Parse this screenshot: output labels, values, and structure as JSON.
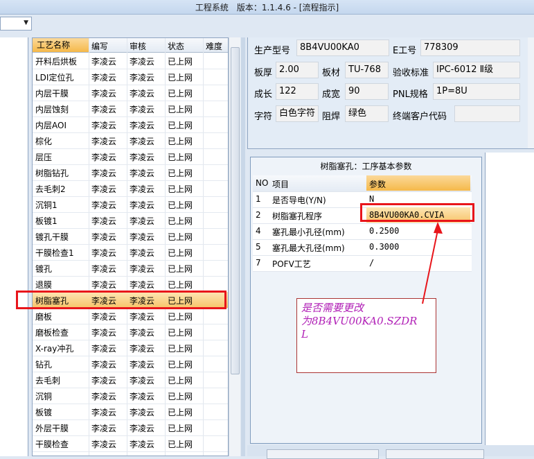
{
  "window": {
    "title": "工程系统　版本：1.1.4.6 - [流程指示]"
  },
  "process_grid": {
    "columns": [
      "工艺名称",
      "编写",
      "审核",
      "状态",
      "难度"
    ],
    "rows": [
      [
        "开料后烘板",
        "李凌云",
        "李凌云",
        "已上网"
      ],
      [
        "LDI定位孔",
        "李凌云",
        "李凌云",
        "已上网"
      ],
      [
        "内层干膜",
        "李凌云",
        "李凌云",
        "已上网"
      ],
      [
        "内层蚀刻",
        "李凌云",
        "李凌云",
        "已上网"
      ],
      [
        "内层AOI",
        "李凌云",
        "李凌云",
        "已上网"
      ],
      [
        "棕化",
        "李凌云",
        "李凌云",
        "已上网"
      ],
      [
        "层压",
        "李凌云",
        "李凌云",
        "已上网"
      ],
      [
        "树脂钻孔",
        "李凌云",
        "李凌云",
        "已上网"
      ],
      [
        "去毛刺2",
        "李凌云",
        "李凌云",
        "已上网"
      ],
      [
        "沉铜1",
        "李凌云",
        "李凌云",
        "已上网"
      ],
      [
        "板镀1",
        "李凌云",
        "李凌云",
        "已上网"
      ],
      [
        "镀孔干膜",
        "李凌云",
        "李凌云",
        "已上网"
      ],
      [
        "干膜检查1",
        "李凌云",
        "李凌云",
        "已上网"
      ],
      [
        "镀孔",
        "李凌云",
        "李凌云",
        "已上网"
      ],
      [
        "退膜",
        "李凌云",
        "李凌云",
        "已上网"
      ],
      [
        "树脂塞孔",
        "李凌云",
        "李凌云",
        "已上网"
      ],
      [
        "磨板",
        "李凌云",
        "李凌云",
        "已上网"
      ],
      [
        "磨板检查",
        "李凌云",
        "李凌云",
        "已上网"
      ],
      [
        "X-ray冲孔",
        "李凌云",
        "李凌云",
        "已上网"
      ],
      [
        "钻孔",
        "李凌云",
        "李凌云",
        "已上网"
      ],
      [
        "去毛刺",
        "李凌云",
        "李凌云",
        "已上网"
      ],
      [
        "沉铜",
        "李凌云",
        "李凌云",
        "已上网"
      ],
      [
        "板镀",
        "李凌云",
        "李凌云",
        "已上网"
      ],
      [
        "外层干膜",
        "李凌云",
        "李凌云",
        "已上网"
      ],
      [
        "干膜检查",
        "李凌云",
        "李凌云",
        "已上网"
      ]
    ]
  },
  "info": {
    "model_label": "生产型号",
    "model_value": "8B4VU00KA0",
    "eno_label": "E工号",
    "eno_value": "778309",
    "thickness_label": "板厚",
    "thickness_value": "2.00",
    "material_label": "板材",
    "material_value": "TU-768",
    "standard_label": "验收标准",
    "standard_value": "IPC-6012 Ⅱ级",
    "length_label": "成长",
    "length_value": "122",
    "width_label": "成宽",
    "width_value": "90",
    "pnl_label": "PNL规格",
    "pnl_value": "1P=8U",
    "char_label": "字符",
    "char_value": "白色字符",
    "mask_label": "阻焊",
    "mask_value": "绿色",
    "customer_label": "终端客户代码",
    "customer_value": ""
  },
  "params": {
    "title": "树脂塞孔：工序基本参数",
    "columns": [
      "NO",
      "项目",
      "参数"
    ],
    "rows": [
      [
        "1",
        "是否导电(Y/N)",
        "N"
      ],
      [
        "2",
        "树脂塞孔程序",
        "8B4VU00KA0.CVIA"
      ],
      [
        "4",
        "塞孔最小孔径(mm)",
        "0.2500"
      ],
      [
        "5",
        "塞孔最大孔径(mm)",
        "0.3000"
      ],
      [
        "7",
        "POFV工艺",
        "/"
      ]
    ]
  },
  "annotation": {
    "line1": "是否需要更改",
    "line2": "为8B4VU00KA0.SZDR",
    "line3": "L",
    "color": "#b01fb6"
  },
  "colors": {
    "highlight": "#f7c46a",
    "alert_red": "#e8151b"
  }
}
